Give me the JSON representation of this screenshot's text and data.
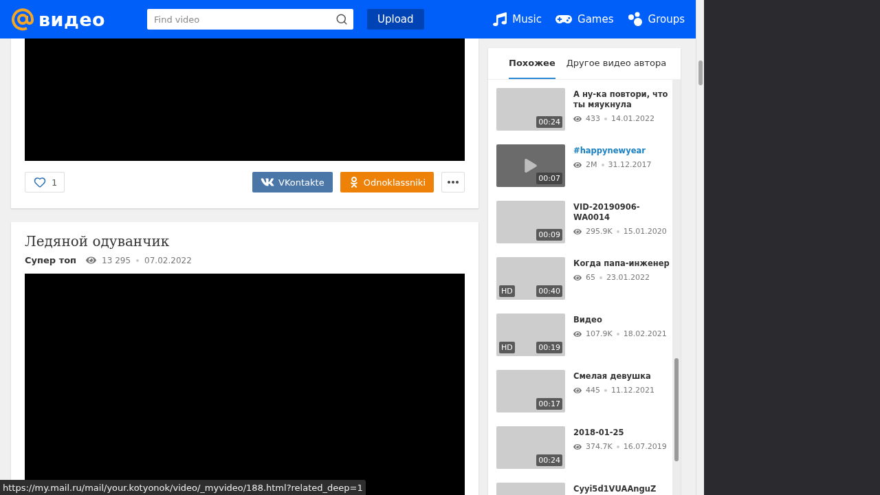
{
  "header": {
    "logo_text": "видео",
    "search": {
      "placeholder": "Find video"
    },
    "upload": "Upload",
    "nav": [
      {
        "label": "Music",
        "kind": "music"
      },
      {
        "label": "Games",
        "kind": "games"
      },
      {
        "label": "Groups",
        "kind": "groups"
      }
    ]
  },
  "current_video": {
    "likes": "1",
    "share": [
      {
        "label": "VKontakte",
        "kind": "vk"
      },
      {
        "label": "Odnoklassniki",
        "kind": "ok"
      }
    ]
  },
  "next_video": {
    "title": "Ледяной одуванчик",
    "author": "Супер топ",
    "views": "13 295",
    "date": "07.02.2022"
  },
  "related": {
    "tabs": [
      {
        "label": "Похожее",
        "selected": true
      },
      {
        "label": "Другое видео автора",
        "selected": false
      }
    ],
    "items": [
      {
        "title": "А ну-ка повтори, что ты мяукнула",
        "views": "433",
        "date": "14.01.2022",
        "duration": "00:24",
        "active": false
      },
      {
        "title": "#happynewyear",
        "views": "2M",
        "date": "31.12.2017",
        "duration": "00:07",
        "active": true
      },
      {
        "title": "VID-20190906-WA0014",
        "views": "295.9K",
        "date": "15.01.2020",
        "duration": "00:09",
        "active": false
      },
      {
        "title": "Когда папа-инженер",
        "views": "65",
        "date": "23.01.2022",
        "duration": "00:40",
        "badge": "HD",
        "active": false
      },
      {
        "title": "Видео",
        "views": "107.9K",
        "date": "18.02.2021",
        "duration": "00:19",
        "badge": "HD",
        "active": false
      },
      {
        "title": "Смелая девушка",
        "views": "445",
        "date": "11.12.2021",
        "duration": "00:17",
        "active": false
      },
      {
        "title": "2018-01-25",
        "views": "374.7K",
        "date": "16.07.2019",
        "duration": "00:24",
        "active": false
      },
      {
        "title": "Cyyi5d1VUAAnguZ",
        "active": false
      }
    ]
  },
  "status_url": "https://my.mail.ru/mail/your.kotyonok/video/_myvideo/188.html?related_deep=1"
}
